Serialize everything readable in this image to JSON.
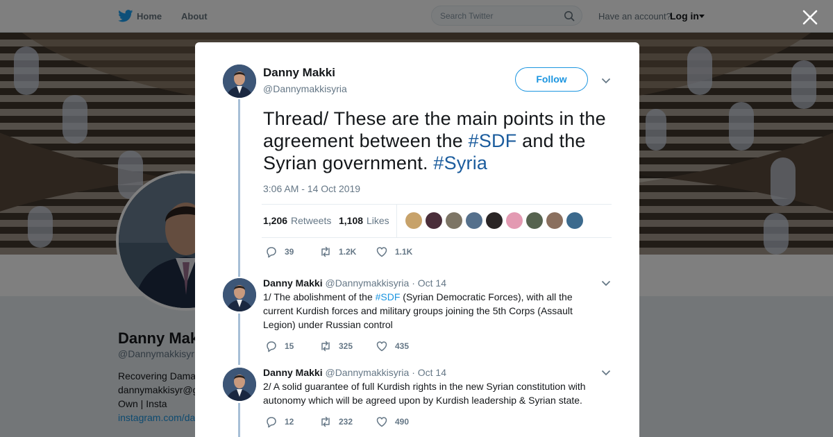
{
  "topbar": {
    "home_label": "Home",
    "about_label": "About",
    "search_placeholder": "Search Twitter",
    "account_prompt": "Have an account?",
    "login_label": "Log in"
  },
  "background_profile": {
    "name": "Danny Mak",
    "handle": "@Dannymakkisyr",
    "bio_line1": "Recovering Dama",
    "bio_line2": "dannymakkisyr@g",
    "bio_line3": "Own | Insta",
    "link": "instagram.com/da"
  },
  "modal": {
    "main_tweet": {
      "author_name": "Danny Makki",
      "author_handle": "@Dannymakkisyria",
      "follow_label": "Follow",
      "text_part1": "Thread/ These are the main points in the agreement between the ",
      "hashtag1": "#SDF",
      "text_part2": " and the Syrian government. ",
      "hashtag2": "#Syria",
      "timestamp": "3:06 AM - 14 Oct 2019",
      "retweets_count": "1,206",
      "retweets_label": "Retweets",
      "likes_count": "1,108",
      "likes_label": "Likes",
      "reply_count": "39",
      "retweet_action_count": "1.2K",
      "like_action_count": "1.1K"
    },
    "replies": [
      {
        "author_name": "Danny Makki",
        "author_handle": "@Dannymakkisyria",
        "date": "· Oct 14",
        "text_part1": "1/ The abolishment of the ",
        "hashtag": "#SDF",
        "text_part2": " (Syrian Democratic Forces), with all the current Kurdish forces and military groups joining the 5th Corps (Assault Legion) under Russian control",
        "reply_count": "15",
        "retweet_count": "325",
        "like_count": "435"
      },
      {
        "author_name": "Danny Makki",
        "author_handle": "@Dannymakkisyria",
        "date": "· Oct 14",
        "text": "2/ A solid guarantee of full Kurdish rights in the new Syrian constitution with autonomy which will be agreed upon by Kurdish leadership & Syrian state.",
        "reply_count": "12",
        "retweet_count": "232",
        "like_count": "490"
      }
    ]
  },
  "colors": {
    "brand_blue": "#1b95e0",
    "hashtag_blue": "#1b5c9d",
    "muted_text": "#657786",
    "thread_line": "#a7bfd6"
  },
  "icons": [
    "twitter-bird-icon",
    "search-icon",
    "caret-down-icon",
    "close-icon",
    "chevron-down-icon",
    "reply-icon",
    "retweet-icon",
    "like-icon"
  ]
}
